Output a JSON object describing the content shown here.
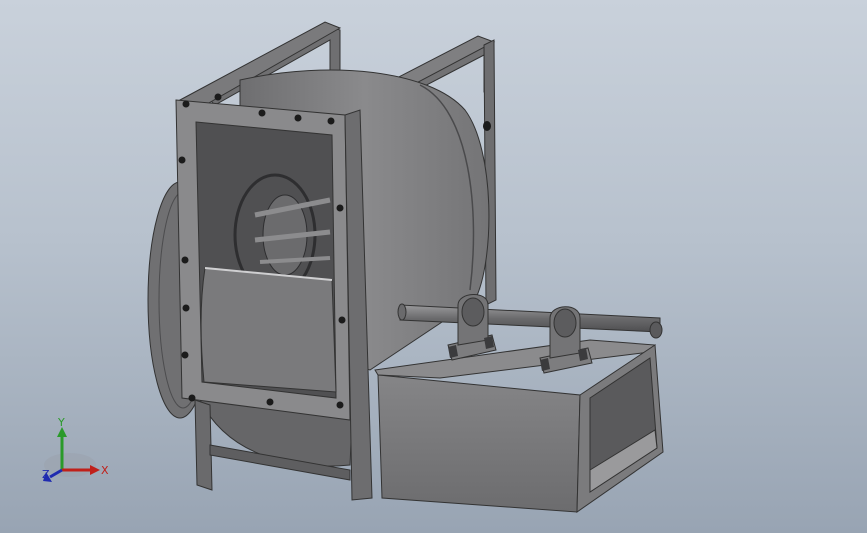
{
  "viewport": {
    "background_top": "#c9d1db",
    "background_bottom": "#98a4b3",
    "model_color": "#7c7c7e"
  },
  "triad": {
    "x_label": "X",
    "y_label": "Y",
    "z_label": "Z",
    "x_color": "#c0201a",
    "y_color": "#2a9a2a",
    "z_color": "#1f2bb0"
  }
}
